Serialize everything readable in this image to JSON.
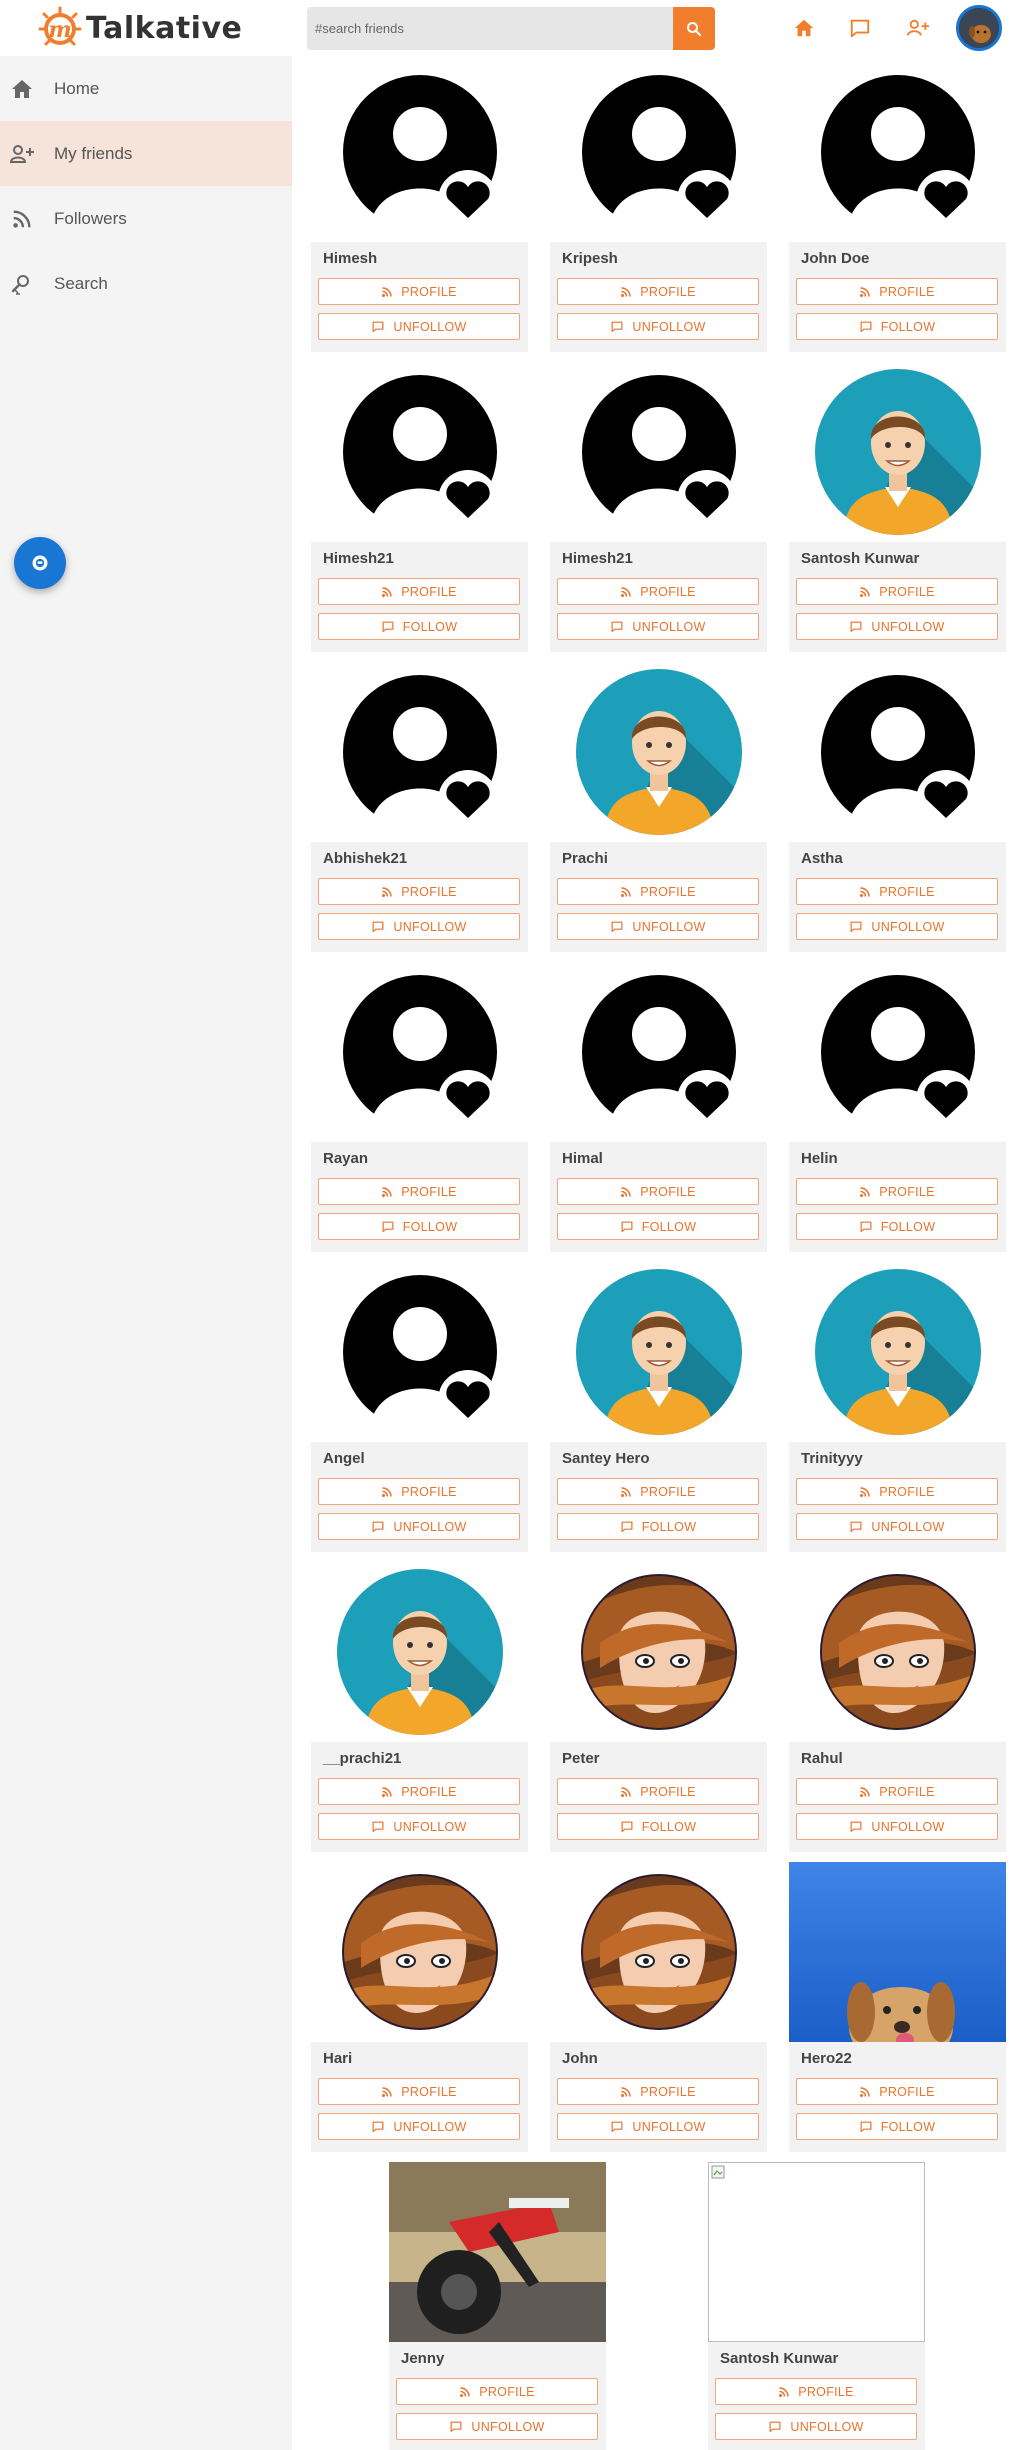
{
  "app": {
    "name": "Talkative"
  },
  "search": {
    "placeholder": "#search friends"
  },
  "sidebar": {
    "items": [
      {
        "label": "Home",
        "icon": "home-icon"
      },
      {
        "label": "My friends",
        "icon": "add-person-icon",
        "active": true
      },
      {
        "label": "Followers",
        "icon": "rss-icon"
      },
      {
        "label": "Search",
        "icon": "person-search-icon"
      }
    ]
  },
  "colors": {
    "accent": "#f07e2c",
    "fab": "#1976d2",
    "active_nav": "#f6e4da"
  },
  "profile_label": "PROFILE",
  "friends": [
    {
      "name": "Himesh",
      "avatar": "default",
      "action": "UNFOLLOW"
    },
    {
      "name": "Kripesh",
      "avatar": "default",
      "action": "UNFOLLOW"
    },
    {
      "name": "John Doe",
      "avatar": "default",
      "action": "FOLLOW"
    },
    {
      "name": "Himesh21",
      "avatar": "default",
      "action": "FOLLOW"
    },
    {
      "name": "Himesh21",
      "avatar": "default",
      "action": "UNFOLLOW"
    },
    {
      "name": "Santosh Kunwar",
      "avatar": "man",
      "action": "UNFOLLOW"
    },
    {
      "name": "Abhishek21",
      "avatar": "default",
      "action": "UNFOLLOW"
    },
    {
      "name": "Prachi",
      "avatar": "man",
      "action": "UNFOLLOW"
    },
    {
      "name": "Astha",
      "avatar": "default",
      "action": "UNFOLLOW"
    },
    {
      "name": "Rayan",
      "avatar": "default",
      "action": "FOLLOW"
    },
    {
      "name": "Himal",
      "avatar": "default",
      "action": "FOLLOW"
    },
    {
      "name": "Helin",
      "avatar": "default",
      "action": "FOLLOW"
    },
    {
      "name": "Angel",
      "avatar": "default",
      "action": "UNFOLLOW"
    },
    {
      "name": "Santey Hero",
      "avatar": "man",
      "action": "FOLLOW"
    },
    {
      "name": "Trinityyy",
      "avatar": "man",
      "action": "UNFOLLOW"
    },
    {
      "name": "__prachi21",
      "avatar": "man",
      "action": "UNFOLLOW"
    },
    {
      "name": "Peter",
      "avatar": "woman",
      "action": "FOLLOW"
    },
    {
      "name": "Rahul",
      "avatar": "woman",
      "action": "UNFOLLOW"
    },
    {
      "name": "Hari",
      "avatar": "woman",
      "action": "UNFOLLOW"
    },
    {
      "name": "John",
      "avatar": "woman",
      "action": "UNFOLLOW"
    },
    {
      "name": "Hero22",
      "avatar": "dog",
      "action": "FOLLOW"
    },
    {
      "name": "Jenny",
      "avatar": "bike",
      "action": "UNFOLLOW"
    },
    {
      "name": "Santosh Kunwar",
      "avatar": "broken",
      "action": "UNFOLLOW"
    }
  ]
}
